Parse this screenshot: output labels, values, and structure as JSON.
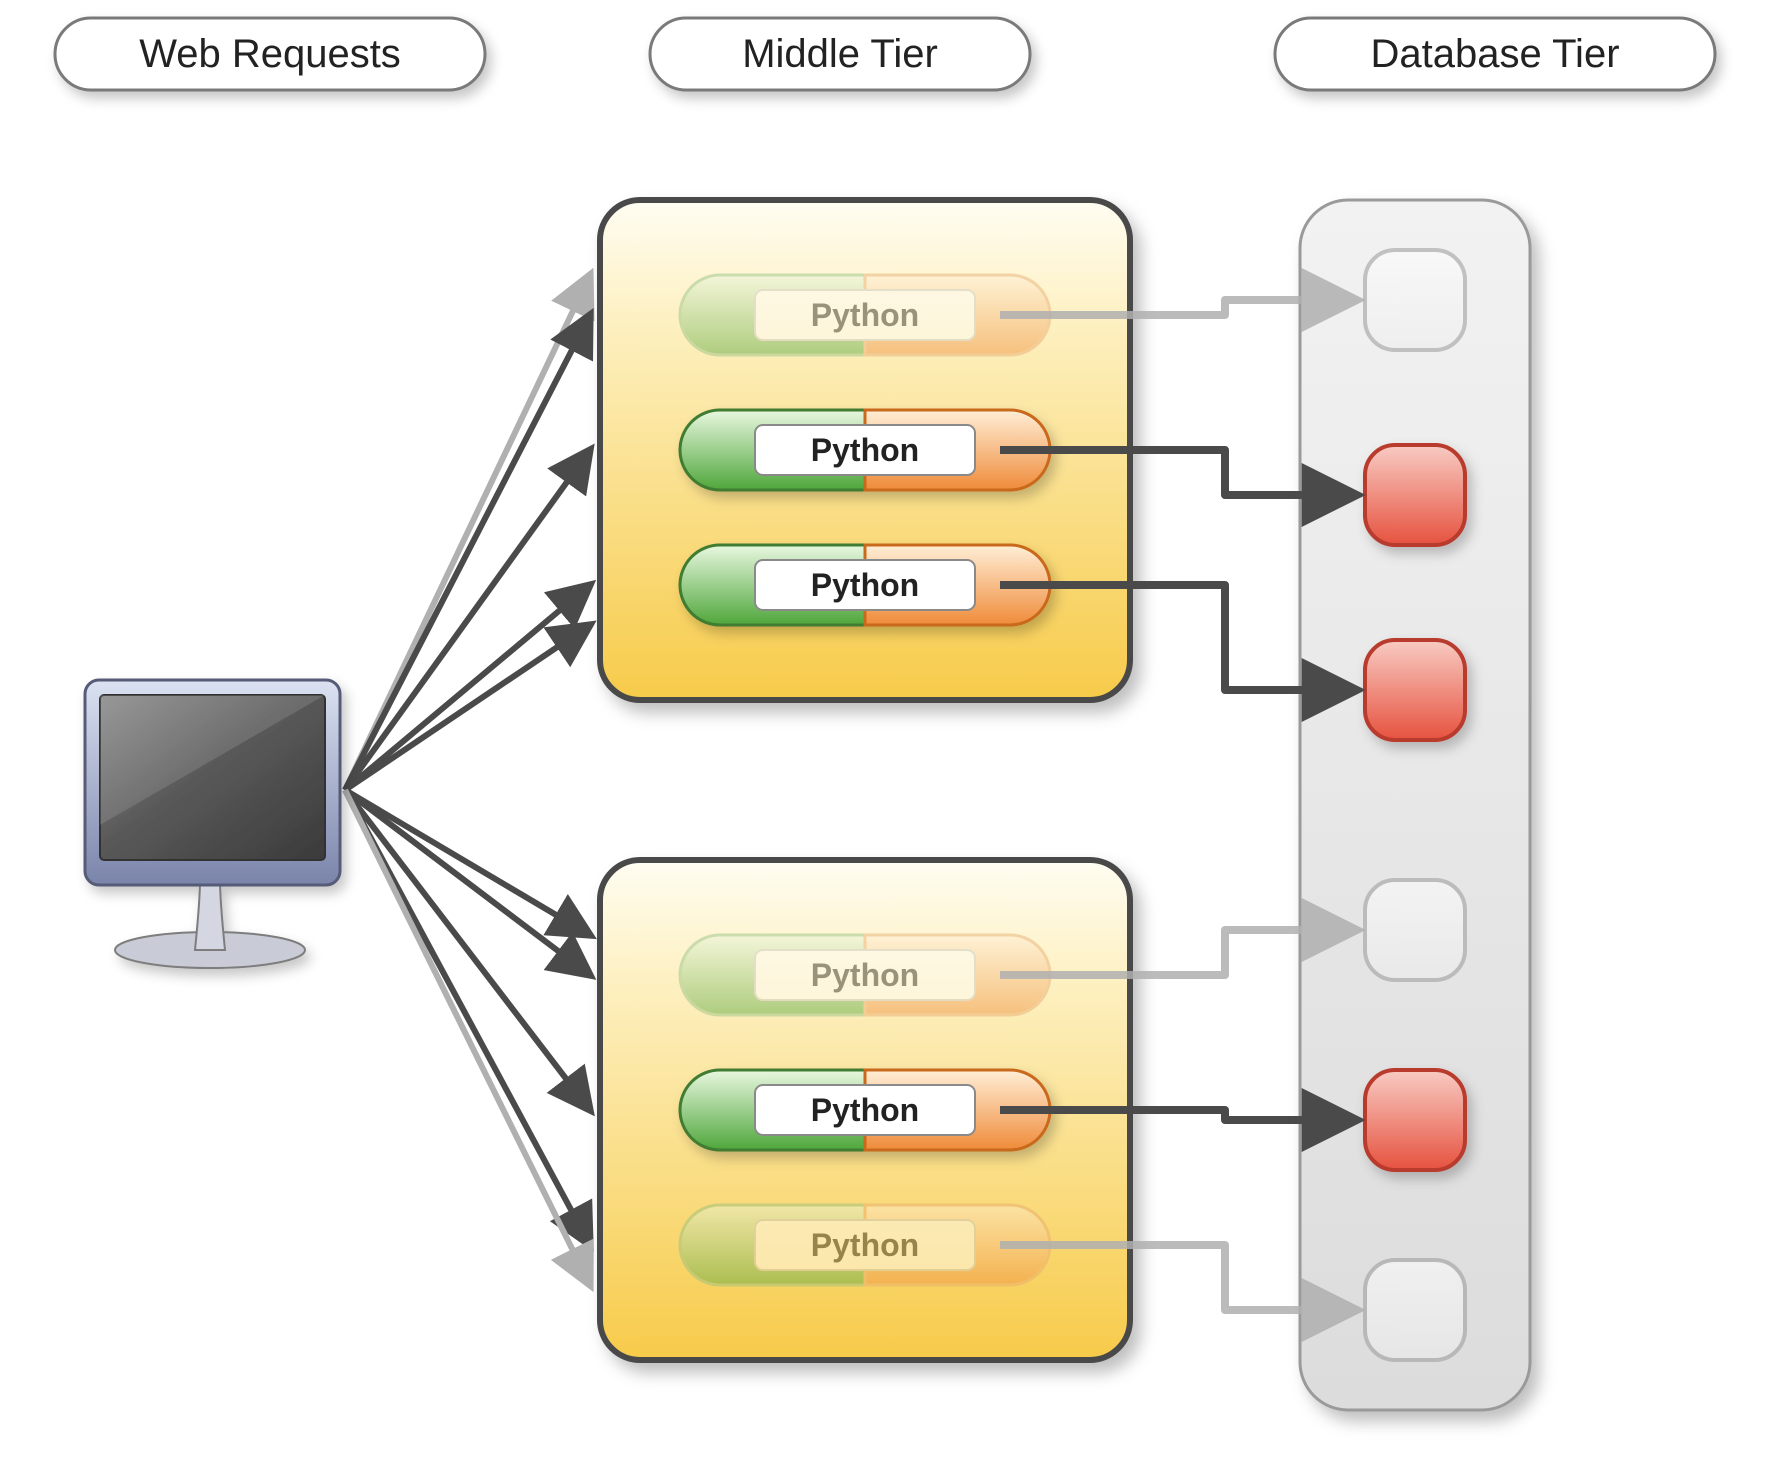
{
  "headers": {
    "web_requests": "Web Requests",
    "middle_tier": "Middle Tier",
    "database_tier": "Database Tier"
  },
  "middle_tier": {
    "servers": [
      {
        "processes": [
          {
            "label": "Python",
            "faded": true
          },
          {
            "label": "Python",
            "faded": false
          },
          {
            "label": "Python",
            "faded": false
          }
        ]
      },
      {
        "processes": [
          {
            "label": "Python",
            "faded": true
          },
          {
            "label": "Python",
            "faded": false
          },
          {
            "label": "Python",
            "faded": true
          }
        ]
      }
    ]
  },
  "database_tier": {
    "nodes": [
      {
        "active": false,
        "faded": true
      },
      {
        "active": true,
        "faded": false
      },
      {
        "active": true,
        "faded": false
      },
      {
        "active": false,
        "faded": true
      },
      {
        "active": true,
        "faded": false
      },
      {
        "active": false,
        "faded": true
      }
    ]
  },
  "colors": {
    "header_border": "#7a7a7a",
    "server_fill_top": "#fff2c8",
    "server_fill_bottom": "#fbcf4a",
    "server_border": "#4a4a4a",
    "pill_green_light": "#d0efc6",
    "pill_green_dark": "#4fa63b",
    "pill_orange_light": "#ffe1be",
    "pill_orange_dark": "#f08b3a",
    "pill_text_bg": "#ffffff",
    "db_panel_fill": "#e7e7e7",
    "db_panel_border": "#999999",
    "db_node_inactive": "#f6f6f6",
    "db_node_active_top": "#f9b7ae",
    "db_node_active_bottom": "#e85b48",
    "arrow_dark": "#4a4a4a",
    "arrow_light": "#b0b0b0"
  }
}
